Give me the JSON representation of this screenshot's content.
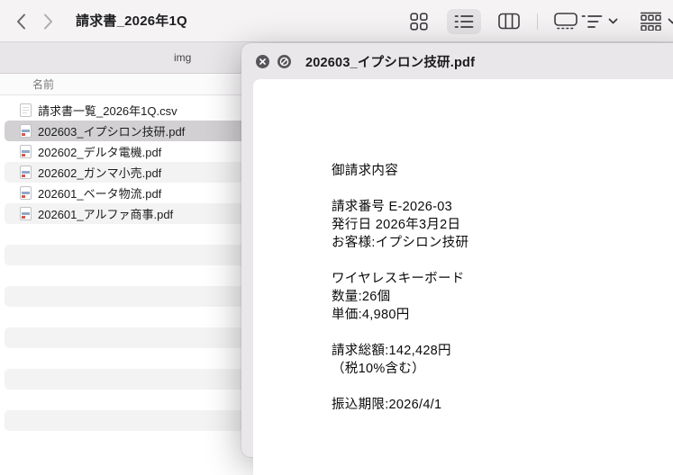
{
  "toolbar": {
    "title": "請求書_2026年1Q",
    "back_icon": "chevron-left-icon",
    "forward_icon": "chevron-right-icon",
    "view_modes": [
      {
        "name": "icon-view",
        "selected": false
      },
      {
        "name": "list-view",
        "selected": true
      },
      {
        "name": "column-view",
        "selected": false
      },
      {
        "name": "gallery-view",
        "selected": false
      }
    ],
    "group_menu_icon": "group-list-icon",
    "display_options_icon": "grid-rows-icon"
  },
  "tab_bar": {
    "label": "img"
  },
  "file_list": {
    "column_header": "名前",
    "rows": [
      {
        "name": "請求書一覧_2026年1Q.csv",
        "type": "csv",
        "selected": false
      },
      {
        "name": "202603_イプシロン技研.pdf",
        "type": "pdf",
        "selected": true
      },
      {
        "name": "202602_デルタ電機.pdf",
        "type": "pdf",
        "selected": false
      },
      {
        "name": "202602_ガンマ小売.pdf",
        "type": "pdf",
        "selected": false
      },
      {
        "name": "202601_ベータ物流.pdf",
        "type": "pdf",
        "selected": false
      },
      {
        "name": "202601_アルファ商事.pdf",
        "type": "pdf",
        "selected": false
      }
    ]
  },
  "preview": {
    "title": "202603_イプシロン技研.pdf",
    "close_icon": "circle-x-icon",
    "block_icon": "circle-slash-icon",
    "document_lines": [
      "御請求内容",
      "",
      "請求番号 E-2026-03",
      "発行日 2026年3月2日",
      "お客様:イプシロン技研",
      "",
      "ワイヤレスキーボード",
      "数量:26個",
      "単価:4,980円",
      "",
      "請求総額:142,428円",
      "（税10%含む）",
      "",
      "振込期限:2026/4/1"
    ]
  },
  "colors": {
    "toolbar_bg": "#f6f3f5",
    "tab_bar_bg": "#e9e6e9",
    "stripe": "#f4f3f4",
    "selection": "#d2d0d2",
    "panel_bg": "#eae7ea",
    "icon_stroke": "#3c3c3e"
  }
}
